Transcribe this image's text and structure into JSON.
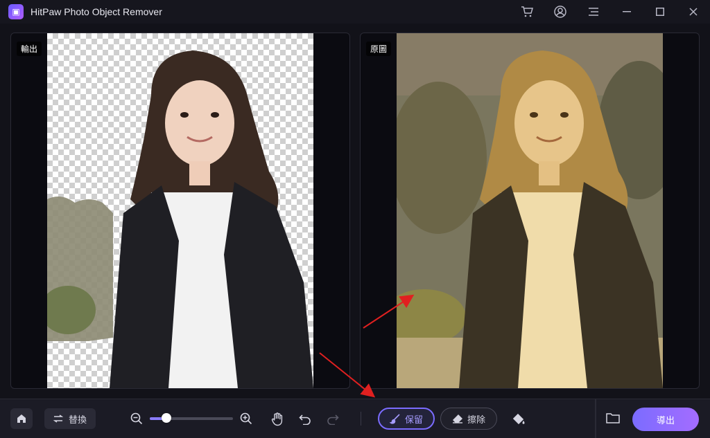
{
  "window": {
    "title": "HitPaw Photo Object Remover",
    "icons": [
      "cart-icon",
      "account-icon",
      "menu-icon",
      "minimize-icon",
      "maximize-icon",
      "close-icon"
    ]
  },
  "panels": {
    "output_label": "輸出",
    "original_label": "原圖"
  },
  "toolbar": {
    "replace_label": "替換",
    "keep_label": "保留",
    "erase_label": "擦除",
    "export_label": "導出",
    "zoom_level": 0.2
  },
  "colors": {
    "accent": "#7b6cff",
    "background": "#121219"
  }
}
